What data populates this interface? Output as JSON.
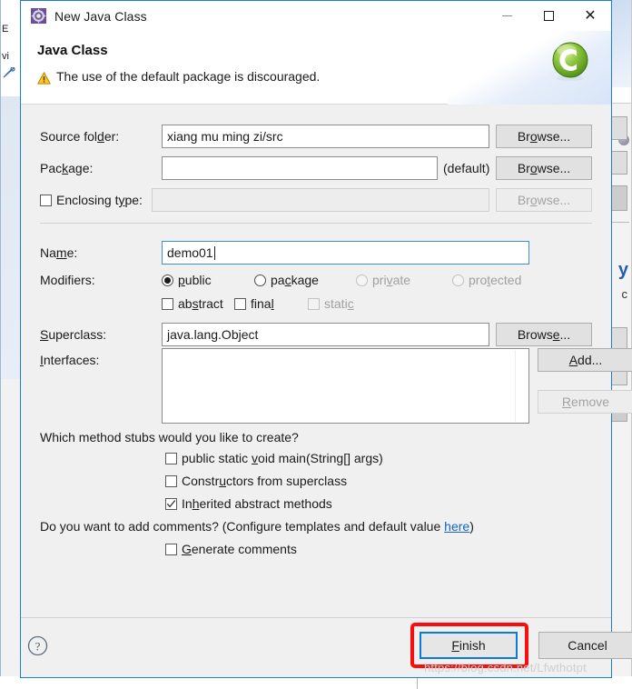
{
  "window": {
    "title": "New Java Class",
    "icon": "java-class-icon",
    "controls": {
      "minimize": "minimize-icon",
      "maximize": "maximize-icon",
      "close": "close-icon"
    }
  },
  "header": {
    "title": "Java Class",
    "message": "The use of the default package is discouraged.",
    "message_icon": "warning-icon",
    "banner_logo": "green-c-logo"
  },
  "form": {
    "source_folder": {
      "label": "Source folder:",
      "value": "xiang mu ming zi/src",
      "button": "Browse..."
    },
    "package": {
      "label": "Package:",
      "value": "",
      "suffix": "(default)",
      "button": "Browse..."
    },
    "enclosing_type": {
      "label": "Enclosing type:",
      "checked": false,
      "value": "",
      "button": "Browse...",
      "disabled": true
    },
    "name": {
      "label": "Name:",
      "value": "demo01",
      "focused": true
    },
    "modifiers": {
      "label": "Modifiers:",
      "radios": [
        {
          "label": "public",
          "selected": true,
          "disabled": false
        },
        {
          "label": "package",
          "selected": false,
          "disabled": false
        },
        {
          "label": "private",
          "selected": false,
          "disabled": true
        },
        {
          "label": "protected",
          "selected": false,
          "disabled": true
        }
      ],
      "checkboxes": [
        {
          "label": "abstract",
          "checked": false,
          "disabled": false
        },
        {
          "label": "final",
          "checked": false,
          "disabled": false
        },
        {
          "label": "static",
          "checked": false,
          "disabled": true
        }
      ]
    },
    "superclass": {
      "label": "Superclass:",
      "value": "java.lang.Object",
      "button": "Browse..."
    },
    "interfaces": {
      "label": "Interfaces:",
      "items": [],
      "add_button": "Add...",
      "remove_button": "Remove",
      "remove_disabled": true
    }
  },
  "stubs": {
    "question": "Which method stubs would you like to create?",
    "options": [
      {
        "label": "public static void main(String[] args)",
        "checked": false
      },
      {
        "label": "Constructors from superclass",
        "checked": false
      },
      {
        "label": "Inherited abstract methods",
        "checked": true
      }
    ]
  },
  "comments": {
    "question_prefix": "Do you want to add comments? (Configure templates and default value ",
    "link": "here",
    "question_suffix": ")",
    "option": {
      "label": "Generate comments",
      "checked": false
    }
  },
  "footer": {
    "help_icon": "help-icon",
    "finish_button": "Finish",
    "cancel_button": "Cancel",
    "highlight_color": "#fb0d0d",
    "focus_color": "#0a7bdb"
  },
  "watermark": "https://blog.csdn.net/Lfwthotpt",
  "background": {
    "left_fragments": [
      "E",
      "vi"
    ],
    "right_letter": "y",
    "right_letter2": "c"
  }
}
